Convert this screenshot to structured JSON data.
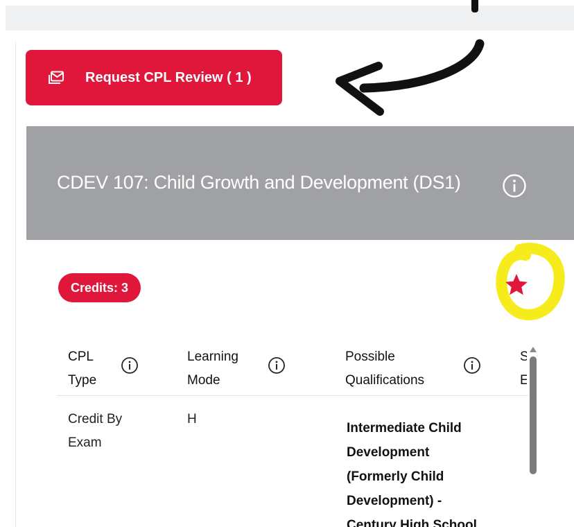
{
  "request_button": {
    "label": "Request CPL Review ( 1 )",
    "icon": "mail-stack-icon"
  },
  "course": {
    "title": "CDEV 107: Child Growth and Development (DS1)",
    "credits_label": "Credits: 3",
    "favorite_icon": "star-icon"
  },
  "table": {
    "headers": [
      {
        "line1": "CPL",
        "line2": "Type"
      },
      {
        "line1": "Learning",
        "line2": "Mode"
      },
      {
        "line1": "Possible",
        "line2": "Qualifications"
      },
      {
        "line1": "S",
        "line2": "E"
      }
    ],
    "rows": [
      {
        "cpl_type_line1": "Credit By",
        "cpl_type_line2": "Exam",
        "learning_mode": "H",
        "qualification_lines": [
          "Intermediate Child",
          "Development",
          "(Formerly Child",
          "Development) -",
          "Century High School"
        ]
      }
    ]
  },
  "colors": {
    "accent_red": "#e0173a",
    "header_gray": "#a0a1a4",
    "highlight_yellow": "#f7ec1b"
  }
}
